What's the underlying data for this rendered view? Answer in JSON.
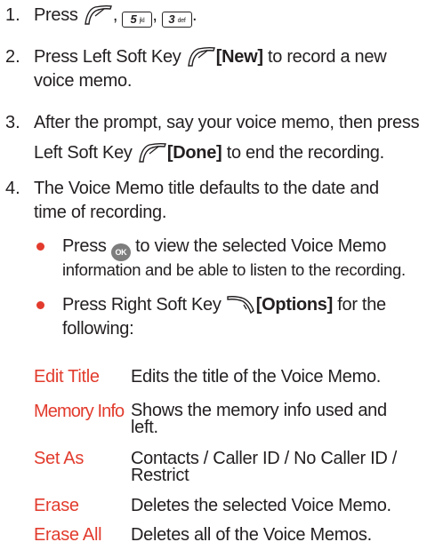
{
  "steps": [
    {
      "number": "1.",
      "text_a": "Press",
      "comma1": ",",
      "key_5_main": "5",
      "key_5_sub": "jkl",
      "comma2": ",",
      "key_3_main": "3",
      "key_3_sub": "def",
      "end": "."
    },
    {
      "number": "2.",
      "line1_pre": "Press Left Soft Key",
      "line1_bold": "[New]",
      "line1_post": "to record a new",
      "line2": "voice memo."
    },
    {
      "number": "3.",
      "line1": "After the prompt, say your voice memo, then press",
      "line2_pre": "Left Soft Key",
      "line2_bold": "[Done]",
      "line2_post": "to end the recording."
    },
    {
      "number": "4.",
      "line1": "The Voice Memo title defaults to the date and",
      "line2": "time of recording."
    }
  ],
  "bullets": [
    {
      "pre": "Press",
      "ok_label": "OK",
      "post": "to view the selected Voice Memo",
      "line2": "information and be able to listen to the recording."
    },
    {
      "pre": "Press Right Soft Key",
      "bold": "[Options]",
      "post": "for the",
      "line2": "following:"
    }
  ],
  "options": [
    {
      "term": "Edit Title",
      "def1": "Edits the title of the Voice Memo."
    },
    {
      "term": "Memory Info",
      "def1": "Shows the memory info used and",
      "def2": "left."
    },
    {
      "term": "Set As",
      "def1": "Contacts / Caller ID / No Caller ID /",
      "def2": "Restrict"
    },
    {
      "term": "Erase",
      "def1": "Deletes the selected Voice Memo."
    },
    {
      "term": "Erase All",
      "def1": "Deletes all of the Voice Memos."
    }
  ],
  "colors": {
    "accent": "#e23b2d",
    "text": "#231f20",
    "ok_button": "#7d7d7d"
  },
  "icons": {
    "left_soft_key": "left-soft-key-icon",
    "right_soft_key": "right-soft-key-icon",
    "ok_key": "ok-key-icon"
  }
}
